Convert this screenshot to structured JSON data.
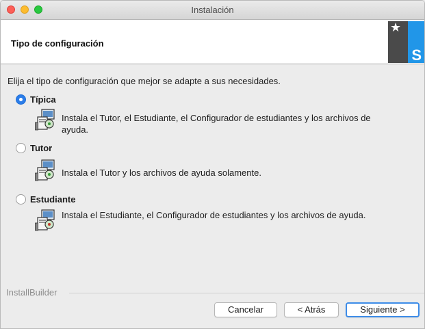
{
  "window": {
    "title": "Instalación"
  },
  "header": {
    "title": "Tipo de configuración",
    "logo_letter": "S"
  },
  "instructions": "Elija el tipo de configuración que mejor se adapte a sus necesidades.",
  "options": [
    {
      "label": "Típica",
      "selected": true,
      "description": "Instala el Tutor, el Estudiante, el Configurador de estudiantes y los archivos de ayuda."
    },
    {
      "label": "Tutor",
      "selected": false,
      "description": "Instala el Tutor y los archivos de ayuda solamente."
    },
    {
      "label": "Estudiante",
      "selected": false,
      "description": "Instala el Estudiante, el Configurador de estudiantes y los archivos de ayuda."
    }
  ],
  "footer": {
    "brand": "InstallBuilder",
    "cancel_label": "Cancelar",
    "back_label": "< Atrás",
    "next_label": "Siguiente >"
  },
  "colors": {
    "accent": "#2b7de9",
    "logo_blue": "#2196e8"
  }
}
